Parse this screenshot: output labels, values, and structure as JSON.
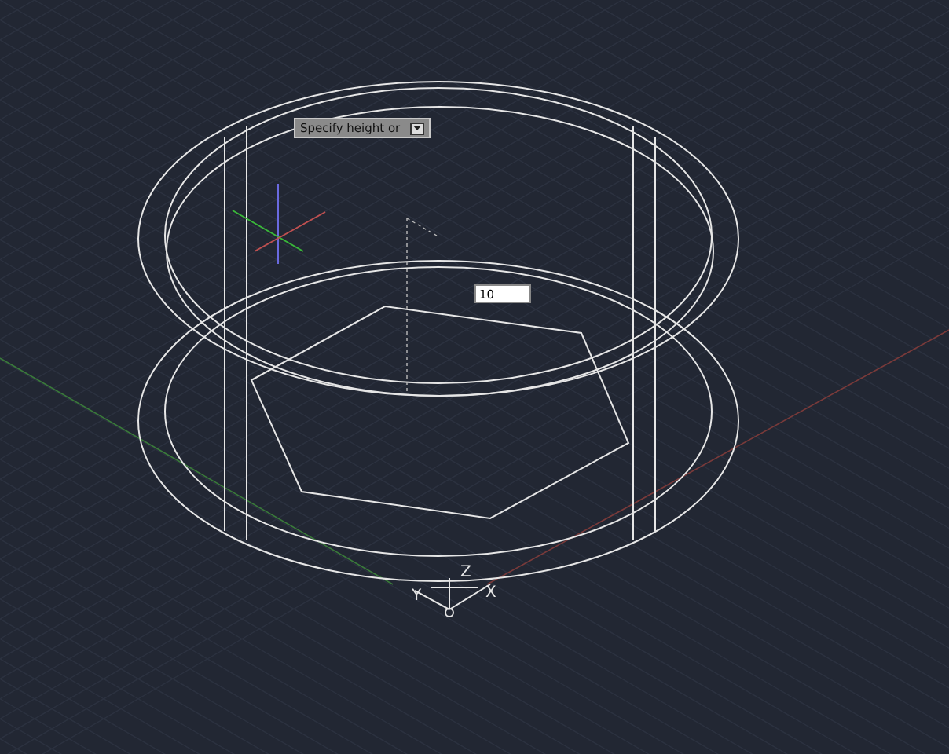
{
  "prompt": {
    "text": "Specify height or"
  },
  "dynamic_input": {
    "value": "10"
  },
  "ucs_icon": {
    "x_label": "X",
    "y_label": "Y",
    "z_label": "Z"
  }
}
